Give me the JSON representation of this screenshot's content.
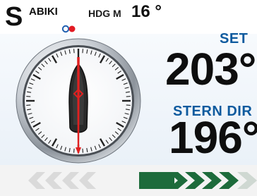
{
  "header": {
    "mode_letter": "S",
    "mode_name": "ABIKI",
    "heading_label": "HDG M",
    "heading_value": "16 °"
  },
  "readouts": {
    "set_label": "SET",
    "set_value": "203°",
    "stern_label": "STERN DIR",
    "stern_value": "196°"
  },
  "colors": {
    "accent_blue": "#0d5a9e",
    "status_dot_blue": "#1f5fb0",
    "status_dot_red": "#e21b23",
    "chevron_active": "#1d6b3b",
    "chevron_inactive": "#dadada",
    "compass_needle": "#e02020",
    "vessel_hull": "#2a2a2a"
  },
  "icons": {
    "compass": "compass-dial-icon",
    "vessel": "vessel-icon",
    "needle": "direction-needle-icon",
    "port_chevrons": "chevron-left-icon",
    "starboard_chevrons": "chevron-right-icon"
  }
}
